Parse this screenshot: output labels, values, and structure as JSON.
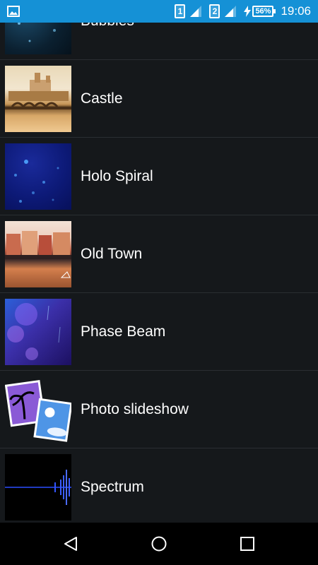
{
  "status_bar": {
    "sim1": "1",
    "sim2": "2",
    "battery": "56%",
    "time": "19:06"
  },
  "list": {
    "items": [
      {
        "label": "Bubbles"
      },
      {
        "label": "Castle"
      },
      {
        "label": "Holo Spiral"
      },
      {
        "label": "Old Town"
      },
      {
        "label": "Phase Beam"
      },
      {
        "label": "Photo slideshow"
      },
      {
        "label": "Spectrum"
      }
    ]
  },
  "colors": {
    "status_bar": "#1591d6",
    "background": "#15181b"
  }
}
